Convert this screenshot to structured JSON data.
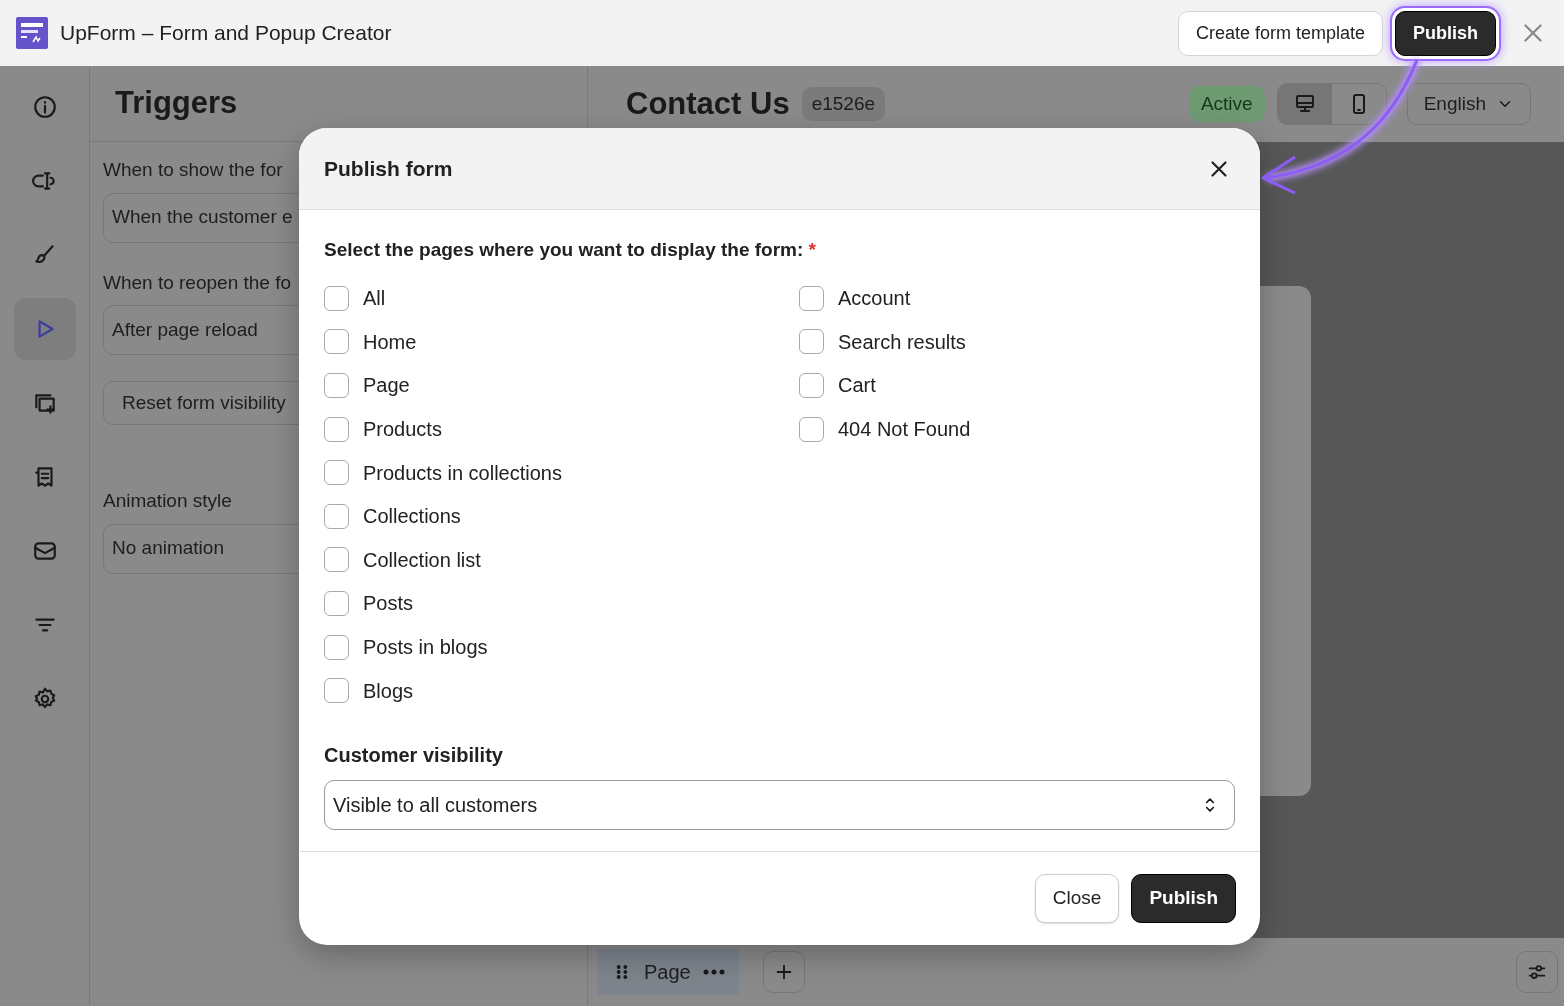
{
  "app_bar": {
    "title": "UpForm – Form and Popup Creator",
    "buttons": [
      {
        "label": "Create form template",
        "kind": "secondary",
        "highlighted": false
      },
      {
        "label": "Publish",
        "kind": "primary",
        "highlighted": true
      }
    ]
  },
  "sidebar": {
    "items": [
      {
        "selected": false
      },
      {
        "selected": false
      },
      {
        "selected": false
      },
      {
        "selected": true
      },
      {
        "selected": false
      },
      {
        "selected": false
      },
      {
        "selected": false
      },
      {
        "selected": false
      },
      {
        "selected": false
      }
    ]
  },
  "triggers_panel": {
    "title": "Triggers",
    "sections": [
      {
        "kind": "select",
        "label": "When to show the for",
        "value": "When the customer e"
      },
      {
        "kind": "select",
        "label": "When to reopen the fo",
        "value": "After page reload"
      },
      {
        "kind": "button",
        "value": "Reset form visibility"
      },
      {
        "kind": "select",
        "label": "Animation style",
        "value": "No animation"
      }
    ]
  },
  "editor": {
    "title": "Contact Us",
    "form_id": "e1526e",
    "status": "Active",
    "view_toggle": [
      {
        "selected": true
      },
      {
        "selected": false
      }
    ],
    "language": "English",
    "page_tab": "Page"
  },
  "modal": {
    "title": "Publish form",
    "prompt": "Select the pages where you want to display the form:",
    "required_mark": "*",
    "page_columns": [
      [
        {
          "label": "All",
          "checked": false
        },
        {
          "label": "Home",
          "checked": false
        },
        {
          "label": "Page",
          "checked": false
        },
        {
          "label": "Products",
          "checked": false
        },
        {
          "label": "Products in collections",
          "checked": false
        },
        {
          "label": "Collections",
          "checked": false
        },
        {
          "label": "Collection list",
          "checked": false
        },
        {
          "label": "Posts",
          "checked": false
        },
        {
          "label": "Posts in blogs",
          "checked": false
        },
        {
          "label": "Blogs",
          "checked": false
        }
      ],
      [
        {
          "label": "Account",
          "checked": false
        },
        {
          "label": "Search results",
          "checked": false
        },
        {
          "label": "Cart",
          "checked": false
        },
        {
          "label": "404 Not Found",
          "checked": false
        }
      ]
    ],
    "visibility": {
      "label": "Customer visibility",
      "value": "Visible to all customers"
    },
    "buttons": [
      {
        "label": "Close",
        "kind": "secondary"
      },
      {
        "label": "Publish",
        "kind": "primary"
      }
    ]
  }
}
